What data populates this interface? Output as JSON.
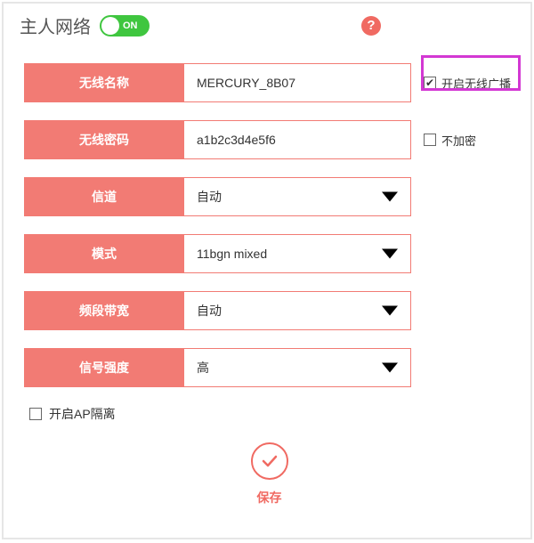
{
  "header": {
    "title": "主人网络",
    "toggle_state": "ON"
  },
  "fields": {
    "ssid": {
      "label": "无线名称",
      "value": "MERCURY_8B07"
    },
    "password": {
      "label": "无线密码",
      "value": "a1b2c3d4e5f6"
    },
    "channel": {
      "label": "信道",
      "value": "自动"
    },
    "mode": {
      "label": "模式",
      "value": "11bgn mixed"
    },
    "bandwidth": {
      "label": "频段带宽",
      "value": "自动"
    },
    "signal": {
      "label": "信号强度",
      "value": "高"
    }
  },
  "side_checks": {
    "broadcast": {
      "label": "开启无线广播",
      "checked": true
    },
    "no_encrypt": {
      "label": "不加密",
      "checked": false
    }
  },
  "bottom_check": {
    "ap_isolation": {
      "label": "开启AP隔离",
      "checked": false
    }
  },
  "save_label": "保存",
  "colors": {
    "accent": "#f27b74",
    "toggle_on": "#3fc63f",
    "highlight": "#d338d3"
  }
}
